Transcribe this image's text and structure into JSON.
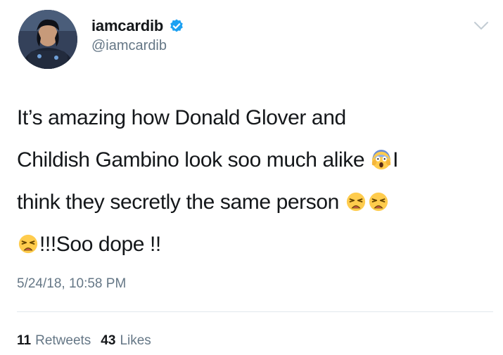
{
  "user": {
    "display_name": "iamcardib",
    "handle": "@iamcardib",
    "verified": true,
    "verified_icon": "verified-badge-icon",
    "avatar_icon": "avatar"
  },
  "tweet": {
    "lines": [
      {
        "segments": [
          {
            "type": "text",
            "value": "It’s amazing how Donald Glover and"
          }
        ]
      },
      {
        "segments": [
          {
            "type": "text",
            "value": "Childish Gambino look soo much alike "
          },
          {
            "type": "emoji",
            "value": "face-screaming-in-fear"
          },
          {
            "type": "text",
            "value": "I"
          }
        ]
      },
      {
        "segments": [
          {
            "type": "text",
            "value": "think they secretly the same person "
          },
          {
            "type": "emoji",
            "value": "weary-face"
          },
          {
            "type": "emoji",
            "value": "weary-face"
          }
        ]
      },
      {
        "segments": [
          {
            "type": "emoji",
            "value": "weary-face"
          },
          {
            "type": "text",
            "value": "!!!Soo dope !!"
          }
        ]
      }
    ]
  },
  "timestamp": "5/24/18, 10:58 PM",
  "stats": {
    "retweets_count": "11",
    "retweets_label": "Retweets",
    "likes_count": "43",
    "likes_label": "Likes"
  },
  "colors": {
    "text": "#14171a",
    "secondary": "#657786",
    "verified": "#1da1f2",
    "divider": "#e1e8ed"
  }
}
